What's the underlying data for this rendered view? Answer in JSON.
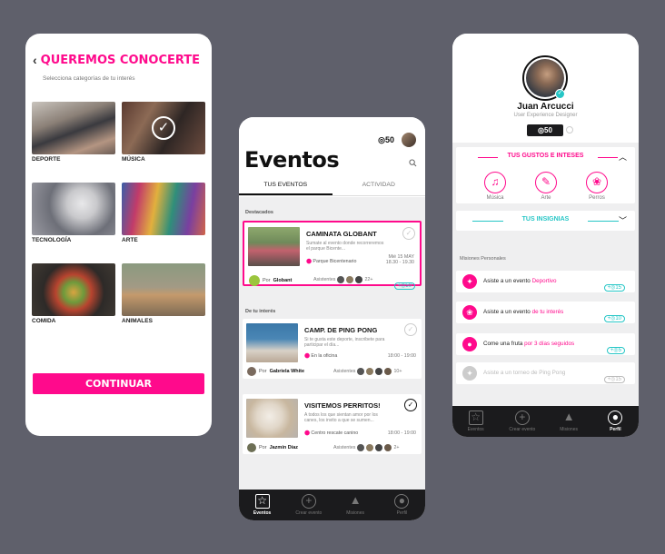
{
  "onboarding": {
    "back_icon": "chevron-left-icon",
    "title": "QUEREMOS CONOCERTE",
    "subtitle": "Selecciona categorías de tu interés",
    "categories": [
      {
        "label": "DEPORTE",
        "selected": false
      },
      {
        "label": "MÚSICA",
        "selected": true
      },
      {
        "label": "TECNOLOGÍA",
        "selected": false
      },
      {
        "label": "ARTE",
        "selected": false
      },
      {
        "label": "COMIDA",
        "selected": false
      },
      {
        "label": "ANIMALES",
        "selected": false
      }
    ],
    "continue_label": "CONTINUAR"
  },
  "events": {
    "coins": "◎50",
    "title": "Eventos",
    "tabs": [
      {
        "label": "TUS EVENTOS",
        "active": true
      },
      {
        "label": "ACTIVIDAD",
        "active": false
      }
    ],
    "featured_label": "Destacados",
    "interest_label": "De tu interés",
    "featured": {
      "title": "CAMINATA GLOBANT",
      "description": "Sumate al evento donde recorreremos el parque Bicente...",
      "location": "Parque Bicentenario",
      "date": "Mié 15 MAY",
      "time": "18.30 - 19.30",
      "by_prefix": "Por",
      "by": "Globant",
      "attendees_label": "Asistentes",
      "attendees_more": "22+",
      "points": "+◎50"
    },
    "items": [
      {
        "title": "CAMP. DE PING PONG",
        "description": "Si te gusta este deporte, inscribete para participar el día...",
        "location": "En la oficina",
        "time": "18:00 - 19:00",
        "by_prefix": "Por",
        "by": "Gabriela White",
        "attendees_label": "Asistentes",
        "attendees_more": "10+",
        "checked": false
      },
      {
        "title": "VISITEMOS PERRITOS!",
        "description": "A todos los que sientan amor por los canes, los invito a que se sumen...",
        "location": "Centro rescate canino",
        "time": "18:00 - 19:00",
        "by_prefix": "Por",
        "by": "Jazmín Díaz",
        "attendees_label": "Asistentes",
        "attendees_more": "2+",
        "checked": true
      }
    ]
  },
  "nav": [
    {
      "label": "Eventos",
      "icon": "calendar-star-icon"
    },
    {
      "label": "Crear evento",
      "icon": "plus-circle-icon"
    },
    {
      "label": "Misiones",
      "icon": "mountain-flag-icon"
    },
    {
      "label": "Perfil",
      "icon": "user-circle-icon"
    }
  ],
  "profile": {
    "name": "Juan Arcucci",
    "role": "User Experience Designer",
    "coins": "◎50",
    "interests_title": "TUS GUSTOS E INTESES",
    "interests": [
      {
        "label": "Música",
        "icon": "music-note-icon"
      },
      {
        "label": "Arte",
        "icon": "paint-brush-icon"
      },
      {
        "label": "Perros",
        "icon": "paw-icon"
      }
    ],
    "badges_title": "TUS INSIGNIAS",
    "missions_label": "Misiones Personales",
    "missions": [
      {
        "text": "Asiste a un evento ",
        "highlight": "Deportivo",
        "points": "+◎15",
        "disabled": false,
        "icon": "runner-icon"
      },
      {
        "text": "Asiste a un evento ",
        "highlight": "de tu interés",
        "points": "+◎10",
        "disabled": false,
        "icon": "paw-icon"
      },
      {
        "text": "Come una fruta ",
        "highlight": "por 3 días seguidos",
        "points": "+◎5",
        "disabled": false,
        "icon": "apple-icon"
      },
      {
        "text": "Asiste a un torneo de Ping Pong",
        "highlight": "",
        "points": "+◎15",
        "disabled": true,
        "icon": "runner-icon"
      }
    ]
  },
  "colors": {
    "accent": "#ff0a8c",
    "points": "#26c6c6",
    "navbar": "#1b1b1d"
  }
}
